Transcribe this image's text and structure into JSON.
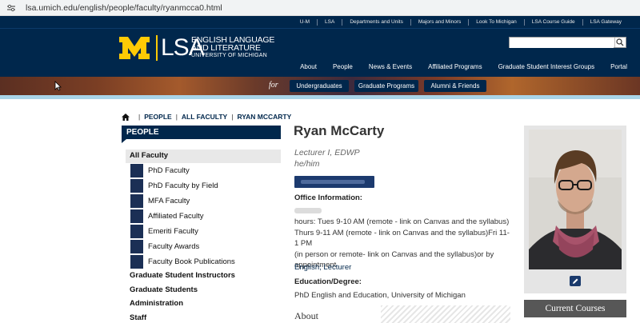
{
  "browser": {
    "url": "lsa.umich.edu/english/people/faculty/ryanmcca0.html"
  },
  "utility_nav": [
    "U-M",
    "LSA",
    "Departments and Units",
    "Majors and Minors",
    "Look To Michigan",
    "LSA Course Guide",
    "LSA Gateway"
  ],
  "header": {
    "logo_lsa": "LSA",
    "dept_line1": "English Language",
    "dept_line2": "and Literature",
    "dept_line3": "University of Michigan",
    "search_placeholder": ""
  },
  "main_nav": [
    "About",
    "People",
    "News & Events",
    "Affiliated Programs",
    "Graduate Student Interest Groups",
    "Portal"
  ],
  "banner": {
    "for_label": "for",
    "buttons": [
      "Undergraduates",
      "Graduate Programs",
      "Alumni & Friends"
    ]
  },
  "breadcrumb": [
    "PEOPLE",
    "ALL FACULTY",
    "RYAN MCCARTY"
  ],
  "sidebar": {
    "heading": "PEOPLE",
    "active": "All Faculty",
    "sub_items": [
      "PhD Faculty",
      "PhD Faculty by Field",
      "MFA Faculty",
      "Affiliated Faculty",
      "Emeriti Faculty",
      "Faculty Awards",
      "Faculty Book Publications"
    ],
    "top_items": [
      "Graduate Student Instructors",
      "Graduate Students",
      "Administration",
      "Staff"
    ]
  },
  "profile": {
    "name": "Ryan McCarty",
    "position": "Lecturer I, EDWP",
    "pronouns": "he/him",
    "office_heading": "Office Information:",
    "hours_line1": "hours: Tues 9-10 AM (remote - link on Canvas and the syllabus)",
    "hours_line2": "Thurs 9-11 AM (remote - link on Canvas and the syllabus)Fri 11-1 PM",
    "hours_line3": "(in person or remote- link on Canvas and the syllabus)or by",
    "hours_line4": "appointment",
    "links": "English; Lecturer",
    "edu_heading": "Education/Degree:",
    "edu": "PhD English and Education, University of Michigan",
    "about_heading": "About"
  },
  "sidebar_right": {
    "courses_button": "Current Courses"
  },
  "colors": {
    "navy": "#00274c",
    "maize": "#ffcb05",
    "stripe": "#a9d4e8"
  }
}
